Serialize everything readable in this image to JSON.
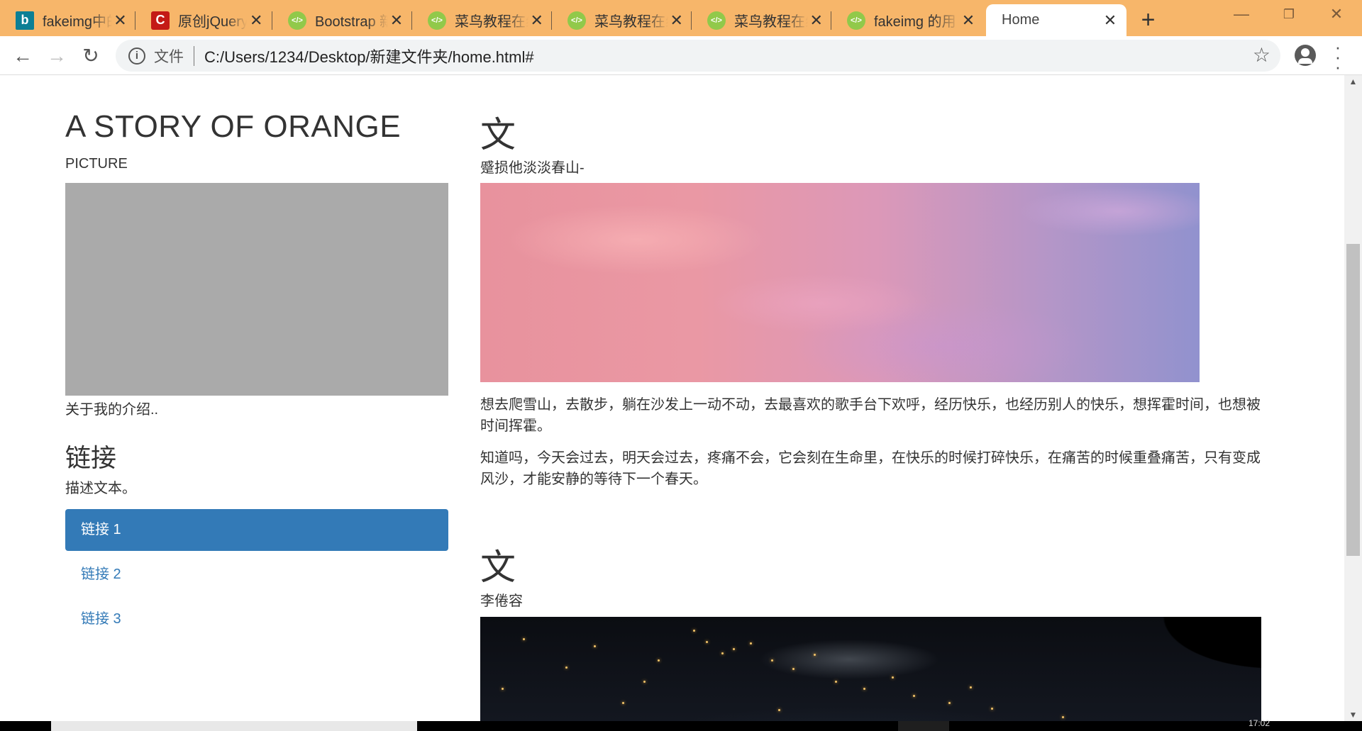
{
  "browser": {
    "tabs": [
      {
        "title": "fakeimg中的",
        "icon": "bing-icon"
      },
      {
        "title": "原创jQuery",
        "icon": "csdn-icon"
      },
      {
        "title": "Bootstrap 新",
        "icon": "runoob-icon"
      },
      {
        "title": "菜鸟教程在线",
        "icon": "runoob-icon"
      },
      {
        "title": "菜鸟教程在线",
        "icon": "runoob-icon"
      },
      {
        "title": "菜鸟教程在线",
        "icon": "runoob-icon"
      },
      {
        "title": "fakeimg 的用",
        "icon": "runoob-icon"
      },
      {
        "title": "Home",
        "icon": "page-icon",
        "active": true
      }
    ],
    "new_tab": "+",
    "address": {
      "security_label": "文件",
      "url": "C:/Users/1234/Desktop/新建文件夹/home.html#"
    },
    "taskbar_time": "17:02"
  },
  "sidebar": {
    "title": "A STORY OF ORANGE",
    "picture_label": "PICTURE",
    "about": "关于我的介绍..",
    "links_heading": "链接",
    "links_desc": "描述文本。",
    "links": [
      {
        "label": "链接 1",
        "active": true
      },
      {
        "label": "链接 2",
        "active": false
      },
      {
        "label": "链接 3",
        "active": false
      }
    ]
  },
  "main": {
    "articles": [
      {
        "heading": "文",
        "subtitle": "蹙损他淡淡春山-",
        "paragraphs": [
          "想去爬雪山，去散步，躺在沙发上一动不动，去最喜欢的歌手台下欢呼，经历快乐，也经历别人的快乐，想挥霍时间，也想被时间挥霍。",
          "知道吗，今天会过去，明天会过去，疼痛不会，它会刻在生命里，在快乐的时候打碎快乐，在痛苦的时候重叠痛苦，只有变成风沙，才能安静的等待下一个春天。"
        ]
      },
      {
        "heading": "文",
        "subtitle": "李倦容"
      }
    ]
  },
  "colors": {
    "tabstrip": "#f7b66a",
    "link": "#337ab7",
    "placeholder_image": "#aaaaaa"
  }
}
